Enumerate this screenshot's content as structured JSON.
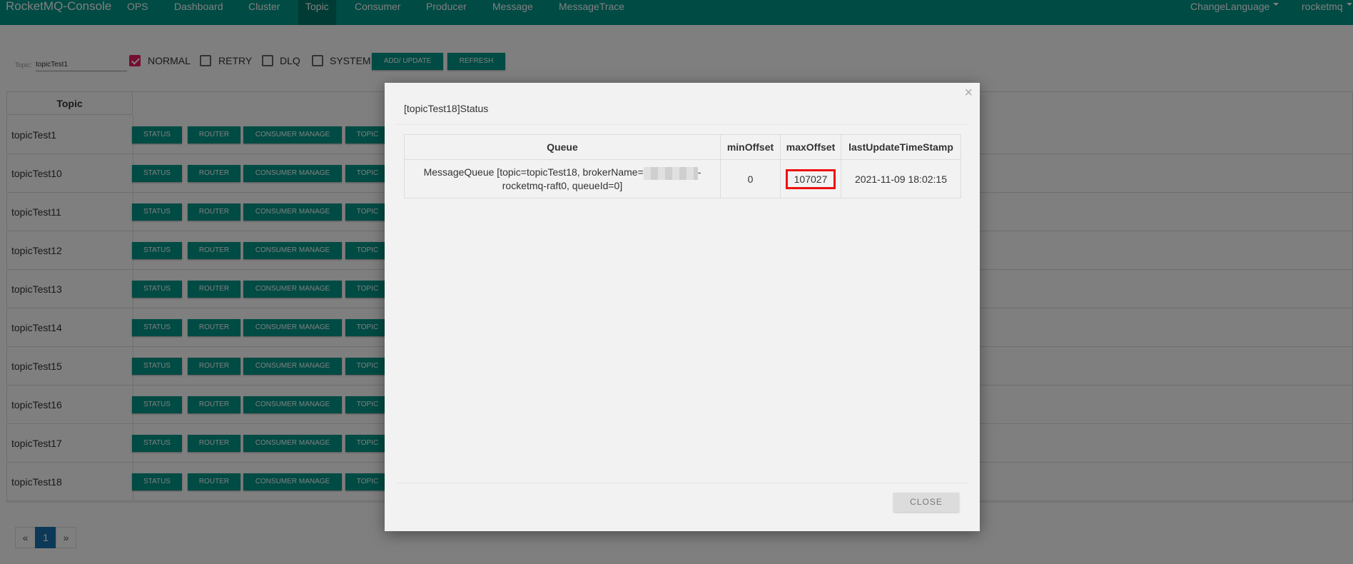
{
  "navbar": {
    "brand": "RocketMQ-Console",
    "items": [
      "OPS",
      "Dashboard",
      "Cluster",
      "Topic",
      "Consumer",
      "Producer",
      "Message",
      "MessageTrace"
    ],
    "active": "Topic",
    "change_language": "ChangeLanguage",
    "user": "rocketmq",
    "color": "#009688"
  },
  "filter": {
    "topic_label": "Topic:",
    "topic_value": "topicTest1",
    "checkboxes": [
      {
        "label": "NORMAL",
        "checked": true
      },
      {
        "label": "RETRY",
        "checked": false
      },
      {
        "label": "DLQ",
        "checked": false
      },
      {
        "label": "SYSTEM",
        "checked": false
      }
    ],
    "add_update_label": "ADD/ UPDATE",
    "refresh_label": "REFRESH"
  },
  "topic_table": {
    "header": "Topic",
    "rows": [
      "topicTest1",
      "topicTest10",
      "topicTest11",
      "topicTest12",
      "topicTest13",
      "topicTest14",
      "topicTest15",
      "topicTest16",
      "topicTest17",
      "topicTest18"
    ],
    "actions": [
      "STATUS",
      "ROUTER",
      "CONSUMER MANAGE",
      "TOPIC"
    ]
  },
  "pagination": {
    "prev": "«",
    "page": "1",
    "next": "»"
  },
  "modal": {
    "title": "[topicTest18]Status",
    "columns": [
      "Queue",
      "minOffset",
      "maxOffset",
      "lastUpdateTimeStamp"
    ],
    "row": {
      "queue_line1_pre": "MessageQueue [topic=topicTest18, brokerName=",
      "queue_line1_post": "-",
      "queue_line2": "rocketmq-raft0, queueId=0]",
      "min_offset": "0",
      "max_offset": "107027",
      "last_update": "2021-11-09 18:02:15"
    },
    "close_label": "CLOSE",
    "close_x": "×",
    "highlight_color": "#e11111"
  }
}
